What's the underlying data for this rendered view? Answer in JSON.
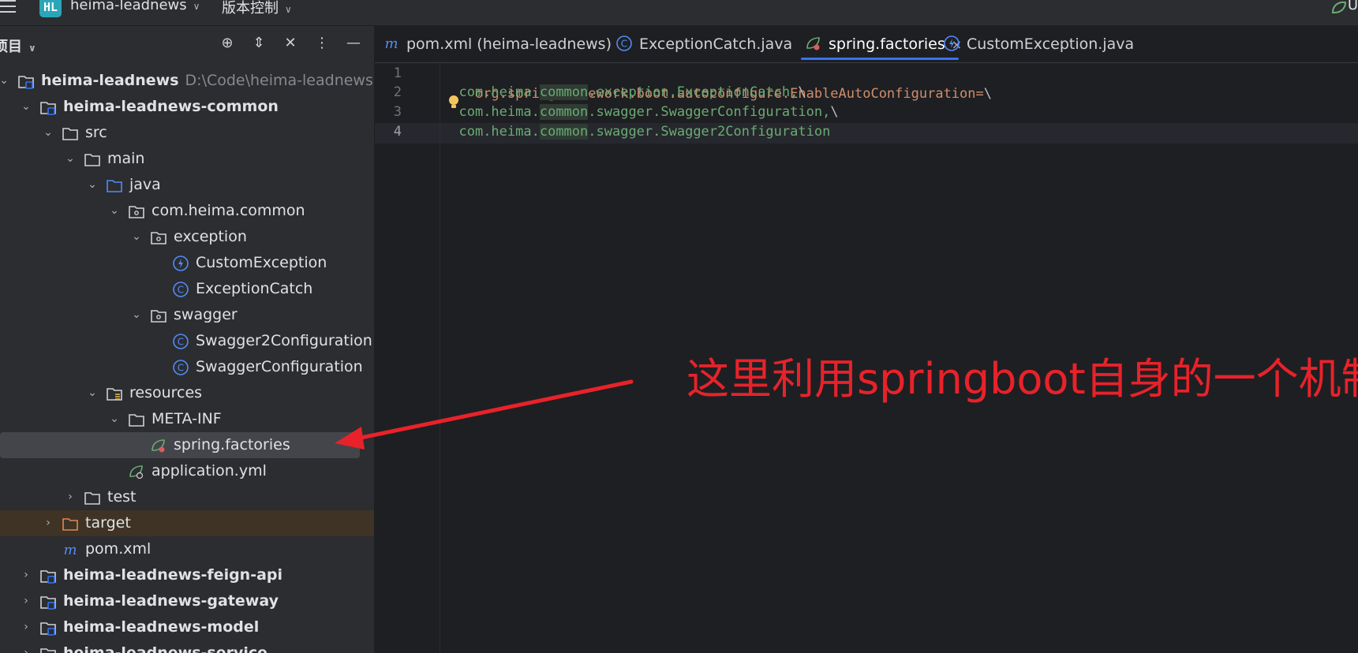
{
  "topbar": {
    "project_badge": "HL",
    "project_name": "heima-leadnews",
    "vcs_label": "版本控制",
    "right_text": "U"
  },
  "panel": {
    "title": "项目",
    "tools": [
      "locate-icon",
      "expand-icon",
      "collapse-icon",
      "more-icon",
      "hide-icon"
    ]
  },
  "tree": [
    {
      "label": "heima-leadnews",
      "path": "D:\\Code\\heima-leadnews",
      "bold": true,
      "indent": 0,
      "expanded": true,
      "icon": "module-folder-icon"
    },
    {
      "label": "heima-leadnews-common",
      "bold": true,
      "indent": 1,
      "expanded": true,
      "icon": "module-folder-icon"
    },
    {
      "label": "src",
      "indent": 2,
      "expanded": true,
      "icon": "folder-icon"
    },
    {
      "label": "main",
      "indent": 3,
      "expanded": true,
      "icon": "folder-icon"
    },
    {
      "label": "java",
      "indent": 4,
      "expanded": true,
      "icon": "source-folder-icon"
    },
    {
      "label": "com.heima.common",
      "indent": 5,
      "expanded": true,
      "icon": "package-icon"
    },
    {
      "label": "exception",
      "indent": 6,
      "expanded": true,
      "icon": "package-icon"
    },
    {
      "label": "CustomException",
      "indent": 7,
      "icon": "exception-class-icon"
    },
    {
      "label": "ExceptionCatch",
      "indent": 7,
      "icon": "class-icon"
    },
    {
      "label": "swagger",
      "indent": 6,
      "expanded": true,
      "icon": "package-icon"
    },
    {
      "label": "Swagger2Configuration",
      "indent": 7,
      "icon": "class-icon"
    },
    {
      "label": "SwaggerConfiguration",
      "indent": 7,
      "icon": "class-icon"
    },
    {
      "label": "resources",
      "indent": 4,
      "expanded": true,
      "icon": "resources-folder-icon"
    },
    {
      "label": "META-INF",
      "indent": 5,
      "expanded": true,
      "icon": "folder-icon"
    },
    {
      "label": "spring.factories",
      "indent": 6,
      "icon": "spring-factories-icon",
      "selected": true
    },
    {
      "label": "application.yml",
      "indent": 5,
      "icon": "spring-config-icon"
    },
    {
      "label": "test",
      "indent": 3,
      "expanded": false,
      "icon": "folder-icon"
    },
    {
      "label": "target",
      "indent": 2,
      "expanded": false,
      "icon": "excluded-folder-icon",
      "excluded": true
    },
    {
      "label": "pom.xml",
      "indent": 2,
      "icon": "maven-icon"
    },
    {
      "label": "heima-leadnews-feign-api",
      "bold": true,
      "indent": 1,
      "expanded": false,
      "icon": "module-folder-icon"
    },
    {
      "label": "heima-leadnews-gateway",
      "bold": true,
      "indent": 1,
      "expanded": false,
      "icon": "module-folder-icon"
    },
    {
      "label": "heima-leadnews-model",
      "bold": true,
      "indent": 1,
      "expanded": false,
      "icon": "module-folder-icon"
    },
    {
      "label": "heima-leadnews-service",
      "bold": true,
      "indent": 1,
      "expanded": false,
      "icon": "module-folder-icon"
    }
  ],
  "tabs": [
    {
      "label": "pom.xml (heima-leadnews)",
      "icon": "maven-icon"
    },
    {
      "label": "ExceptionCatch.java",
      "icon": "class-icon"
    },
    {
      "label": "spring.factories",
      "icon": "spring-factories-icon",
      "active": true,
      "close": "×"
    },
    {
      "label": "CustomException.java",
      "icon": "exception-class-icon"
    }
  ],
  "editor": {
    "line_numbers": [
      "1",
      "2",
      "3",
      "4"
    ],
    "lines": [
      {
        "key": "org.springframework.boot.autoconfigure.EnableAutoConfiguration",
        "eq": "=",
        "esc": "\\"
      },
      {
        "pre": "com.heima.",
        "hl": "common",
        "post": ".exception.ExceptionCatch,",
        "esc": "\\"
      },
      {
        "pre": "com.heima.",
        "hl": "common",
        "post": ".swagger.SwaggerConfiguration,",
        "esc": "\\"
      },
      {
        "pre": "com.heima.",
        "hl": "common",
        "post": ".swagger.Swagger2Configuration",
        "esc": ""
      }
    ]
  },
  "annotation": {
    "text": "这里利用springboot自身的一个机制",
    "color": "#e8222a"
  }
}
